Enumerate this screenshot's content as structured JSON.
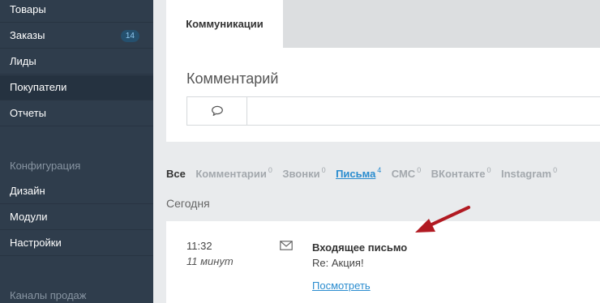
{
  "sidebar": {
    "items": [
      {
        "label": "Товары"
      },
      {
        "label": "Заказы",
        "badge": "14"
      },
      {
        "label": "Лиды"
      },
      {
        "label": "Покупатели",
        "active": true
      },
      {
        "label": "Отчеты"
      }
    ],
    "section_config": "Конфигурация",
    "config_items": [
      {
        "label": "Дизайн"
      },
      {
        "label": "Модули"
      },
      {
        "label": "Настройки"
      }
    ],
    "section_channels": "Каналы продаж"
  },
  "main": {
    "tabs": [
      {
        "label": "Коммуникации",
        "active": true
      }
    ],
    "comment": {
      "title": "Комментарий",
      "icon": "speech-bubble-icon",
      "value": ""
    },
    "filters": [
      {
        "label": "Все",
        "count": "",
        "current": true
      },
      {
        "label": "Комментарии",
        "count": "0"
      },
      {
        "label": "Звонки",
        "count": "0"
      },
      {
        "label": "Письма",
        "count": "4",
        "link": true
      },
      {
        "label": "СМС",
        "count": "0"
      },
      {
        "label": "ВКонтакте",
        "count": "0"
      },
      {
        "label": "Instagram",
        "count": "0"
      }
    ],
    "day_label": "Сегодня",
    "event": {
      "time": "11:32",
      "ago": "11 минут",
      "icon": "envelope-icon",
      "title": "Входящее письмо",
      "subject": "Re: Акция!",
      "link": "Посмотреть"
    }
  },
  "colors": {
    "sidebar_bg": "#2f3d4c",
    "accent": "#2a8ccf",
    "annotation_arrow": "#b11a22"
  }
}
